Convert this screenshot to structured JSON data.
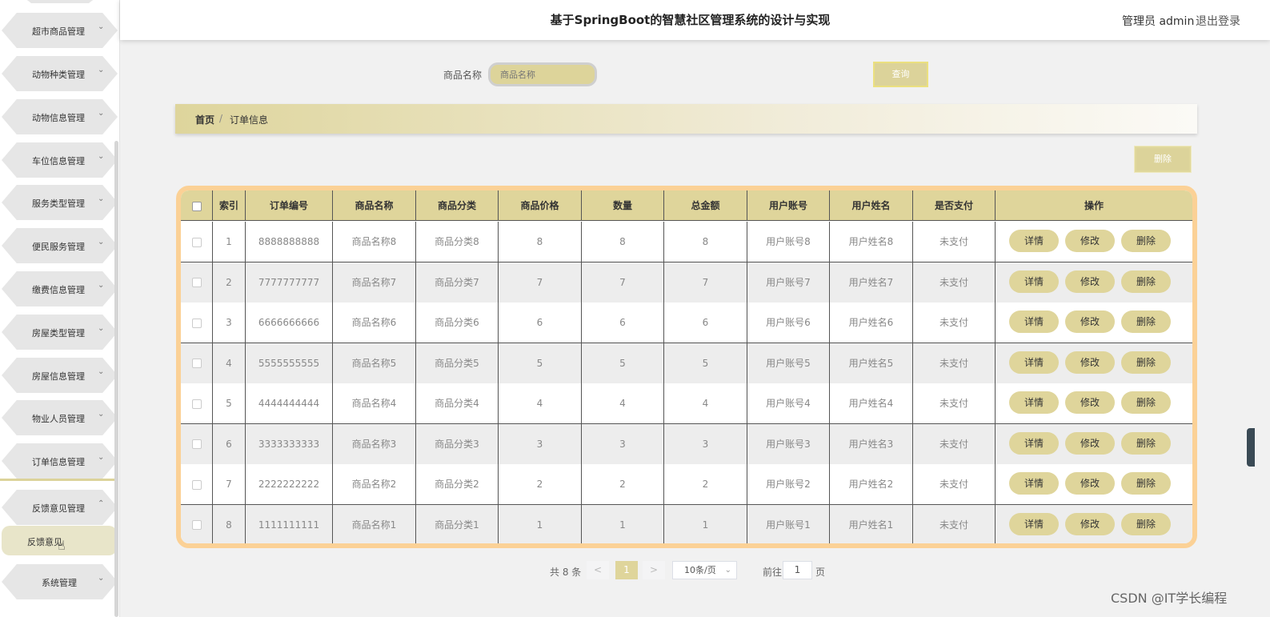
{
  "header": {
    "title": "基于SpringBoot的智慧社区管理系统的设计与实现",
    "admin": "管理员 admin",
    "logout": "退出登录"
  },
  "sidebar": {
    "items": [
      {
        "label": "超市商品管理",
        "chevron": "⌄"
      },
      {
        "label": "动物种类管理",
        "chevron": "⌄"
      },
      {
        "label": "动物信息管理",
        "chevron": "⌄"
      },
      {
        "label": "车位信息管理",
        "chevron": "⌄"
      },
      {
        "label": "服务类型管理",
        "chevron": "⌄"
      },
      {
        "label": "便民服务管理",
        "chevron": "⌄"
      },
      {
        "label": "缴费信息管理",
        "chevron": "⌄"
      },
      {
        "label": "房屋类型管理",
        "chevron": "⌄"
      },
      {
        "label": "房屋信息管理",
        "chevron": "⌄"
      },
      {
        "label": "物业人员管理",
        "chevron": "⌄"
      },
      {
        "label": "订单信息管理",
        "chevron": "⌄"
      },
      {
        "label": "反馈意见管理",
        "chevron": "⌃"
      },
      {
        "label": "系统管理",
        "chevron": "⌄"
      }
    ],
    "sub_item": "反馈意见"
  },
  "search": {
    "label": "商品名称",
    "placeholder": "商品名称",
    "button": "查询"
  },
  "breadcrumb": {
    "home": "首页",
    "separator": "/",
    "current": "订单信息"
  },
  "toolbar": {
    "delete": "删除"
  },
  "table": {
    "columns": [
      "",
      "索引",
      "订单编号",
      "商品名称",
      "商品分类",
      "商品价格",
      "数量",
      "总金额",
      "用户账号",
      "用户姓名",
      "是否支付",
      "操作"
    ],
    "actions": [
      "详情",
      "修改",
      "删除"
    ],
    "rows": [
      [
        "1",
        "8888888888",
        "商品名称8",
        "商品分类8",
        "8",
        "8",
        "8",
        "用户账号8",
        "用户姓名8",
        "未支付"
      ],
      [
        "2",
        "7777777777",
        "商品名称7",
        "商品分类7",
        "7",
        "7",
        "7",
        "用户账号7",
        "用户姓名7",
        "未支付"
      ],
      [
        "3",
        "6666666666",
        "商品名称6",
        "商品分类6",
        "6",
        "6",
        "6",
        "用户账号6",
        "用户姓名6",
        "未支付"
      ],
      [
        "4",
        "5555555555",
        "商品名称5",
        "商品分类5",
        "5",
        "5",
        "5",
        "用户账号5",
        "用户姓名5",
        "未支付"
      ],
      [
        "5",
        "4444444444",
        "商品名称4",
        "商品分类4",
        "4",
        "4",
        "4",
        "用户账号4",
        "用户姓名4",
        "未支付"
      ],
      [
        "6",
        "3333333333",
        "商品名称3",
        "商品分类3",
        "3",
        "3",
        "3",
        "用户账号3",
        "用户姓名3",
        "未支付"
      ],
      [
        "7",
        "2222222222",
        "商品名称2",
        "商品分类2",
        "2",
        "2",
        "2",
        "用户账号2",
        "用户姓名2",
        "未支付"
      ],
      [
        "8",
        "1111111111",
        "商品名称1",
        "商品分类1",
        "1",
        "1",
        "1",
        "用户账号1",
        "用户姓名1",
        "未支付"
      ]
    ]
  },
  "pagination": {
    "total": "共 8 条",
    "prev": "<",
    "current": "1",
    "next": ">",
    "page_size": "10条/页",
    "page_size_arrow": "⌄",
    "goto": "前往",
    "goto_value": "1",
    "page_suffix": "页"
  },
  "watermark": "CSDN @IT学长编程"
}
